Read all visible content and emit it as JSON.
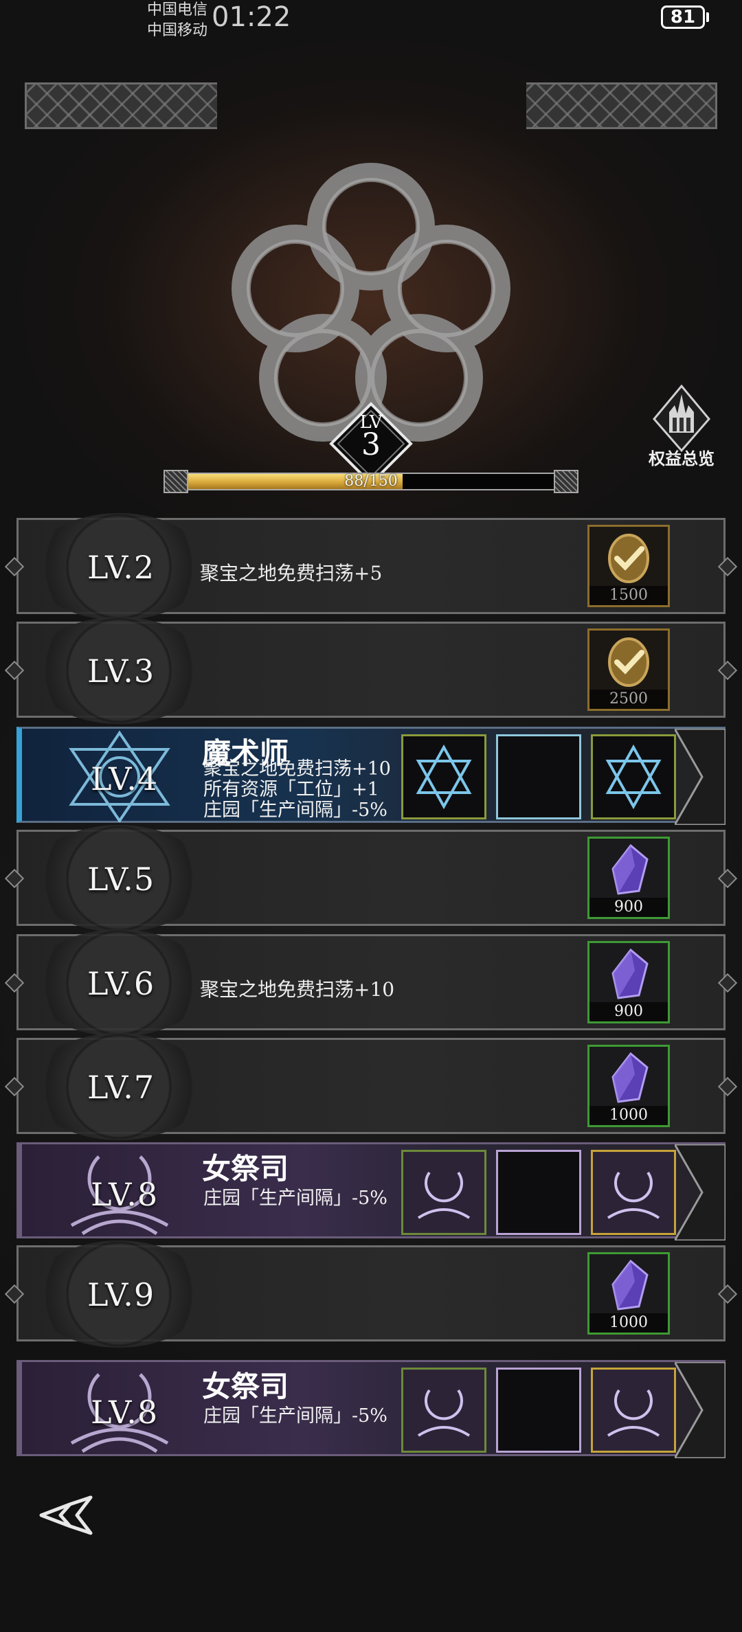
{
  "status_bar": {
    "carrier_1": "中国电信",
    "carrier_2": "中国移动",
    "time": "01:22",
    "battery": "81"
  },
  "header": {
    "level_label": "LV",
    "level_value": "3",
    "xp_text": "88/150",
    "xp_progress": 0.5867,
    "perks_label": "权益总览"
  },
  "rows": [
    {
      "level": "LV.2",
      "desc": "聚宝之地免费扫荡+5",
      "reward": {
        "type": "coin",
        "amount": "1500",
        "claimed": true
      }
    },
    {
      "level": "LV.3",
      "desc": "",
      "reward": {
        "type": "coin",
        "amount": "2500",
        "claimed": true
      }
    },
    {
      "level": "LV.4",
      "title": "魔术师",
      "lines": [
        "聚宝之地免费扫荡+10",
        "所有资源「工位」+1",
        "庄园「生产间隔」-5%"
      ]
    },
    {
      "level": "LV.5",
      "desc": "",
      "reward": {
        "type": "crystal",
        "amount": "900"
      }
    },
    {
      "level": "LV.6",
      "desc": "聚宝之地免费扫荡+10",
      "reward": {
        "type": "crystal",
        "amount": "900"
      }
    },
    {
      "level": "LV.7",
      "desc": "",
      "reward": {
        "type": "crystal",
        "amount": "1000"
      }
    },
    {
      "level": "LV.8",
      "title": "女祭司",
      "lines": [
        "庄园「生产间隔」-5%"
      ]
    },
    {
      "level": "LV.9",
      "desc": "",
      "reward": {
        "type": "crystal",
        "amount": "1000"
      }
    },
    {
      "level": "LV.8",
      "title": "女祭司",
      "lines": [
        "庄园「生产间隔」-5%"
      ]
    }
  ],
  "colors": {
    "xp_fill": "#d9a93a",
    "mage_accent": "#38a2d6",
    "priest_accent": "#a88ad6",
    "reward_green": "#3e9a34",
    "reward_gold": "#8c6d2c"
  }
}
